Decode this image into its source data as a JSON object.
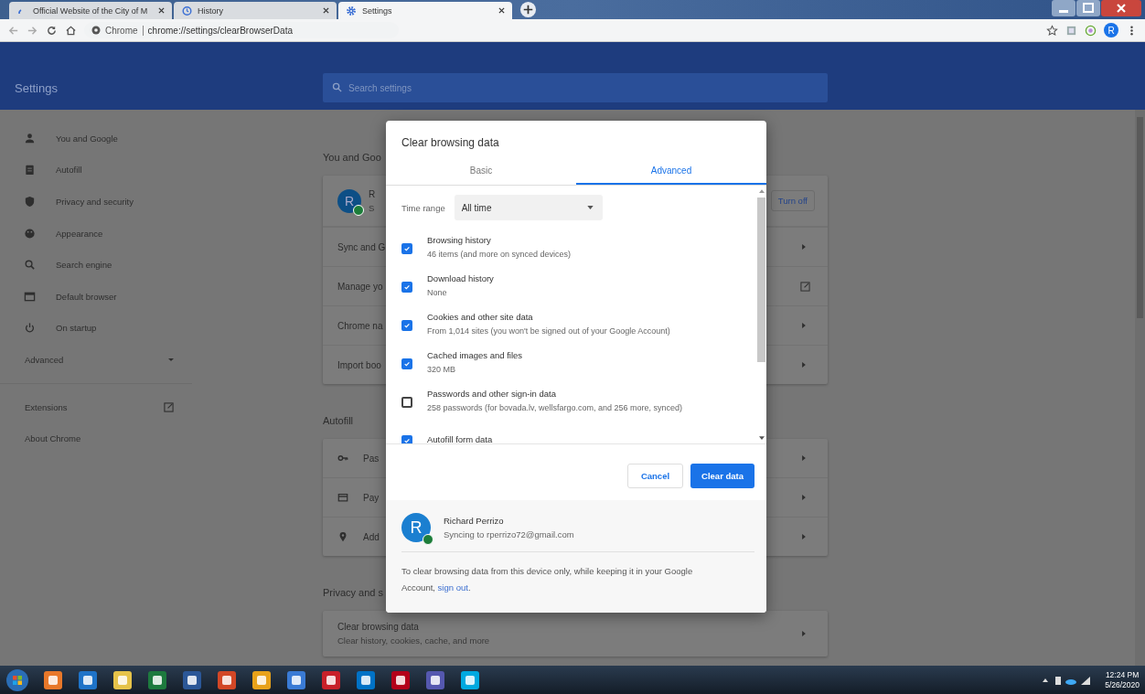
{
  "browser": {
    "tabs": [
      {
        "title": "Official Website of the City of M",
        "selected": false
      },
      {
        "title": "History",
        "selected": false
      },
      {
        "title": "Settings",
        "selected": true
      }
    ],
    "address": {
      "site": "Chrome",
      "url": "chrome://settings/clearBrowserData"
    },
    "profile_initial": "R"
  },
  "settings": {
    "title": "Settings",
    "search": {
      "placeholder": "Search settings"
    },
    "sidebar": {
      "items": [
        {
          "label": "You and Google"
        },
        {
          "label": "Autofill"
        },
        {
          "label": "Privacy and security"
        },
        {
          "label": "Appearance"
        },
        {
          "label": "Search engine"
        },
        {
          "label": "Default browser"
        },
        {
          "label": "On startup"
        }
      ],
      "advanced": {
        "label": "Advanced",
        "expanded": false
      },
      "links": [
        {
          "label": "Extensions",
          "external": true
        },
        {
          "label": "About Chrome",
          "external": false
        }
      ]
    },
    "sections": [
      {
        "heading": "You and Goo",
        "profile": {
          "initial": "R",
          "name": "R",
          "status": "S",
          "button": "Turn off"
        },
        "rows": [
          {
            "label": "Sync and G",
            "kind": "arrow"
          },
          {
            "label": "Manage yo",
            "kind": "external"
          },
          {
            "label": "Chrome na",
            "kind": "arrow"
          },
          {
            "label": "Import boo",
            "kind": "arrow"
          }
        ]
      },
      {
        "heading": "Autofill",
        "rows": [
          {
            "label": "Pas",
            "kind": "arrow"
          },
          {
            "label": "Pay",
            "kind": "arrow"
          },
          {
            "label": "Add",
            "kind": "arrow"
          }
        ]
      },
      {
        "heading": "Privacy and s",
        "rows": [
          {
            "label": "Clear browsing data",
            "sublabel": "Clear history, cookies, cache, and more",
            "kind": "arrow"
          }
        ]
      }
    ]
  },
  "dialog": {
    "title": "Clear browsing data",
    "tabs": [
      {
        "label": "Basic",
        "selected": false
      },
      {
        "label": "Advanced",
        "selected": true
      }
    ],
    "time_range": {
      "label": "Time range",
      "value": "All time"
    },
    "items": [
      {
        "title": "Browsing history",
        "detail": "46 items (and more on synced devices)",
        "checked": true
      },
      {
        "title": "Download history",
        "detail": "None",
        "checked": true
      },
      {
        "title": "Cookies and other site data",
        "detail": "From 1,014 sites (you won't be signed out of your Google Account)",
        "checked": true
      },
      {
        "title": "Cached images and files",
        "detail": "320 MB",
        "checked": true
      },
      {
        "title": "Passwords and other sign-in data",
        "detail": "258 passwords (for bovada.lv, wellsfargo.com, and 256 more, synced)",
        "checked": false
      },
      {
        "title": "Autofill form data",
        "checked": true
      }
    ],
    "buttons": {
      "cancel": "Cancel",
      "confirm": "Clear data"
    },
    "account": {
      "initial": "R",
      "name": "Richard Perrizo",
      "email": "Syncing to rperrizo72@gmail.com"
    },
    "note": {
      "text": "To clear browsing data from this device only, while keeping it in your Google Account, ",
      "link": "sign out",
      "end": "."
    }
  },
  "taskbar": {
    "time": "12:24 PM",
    "date": "5/26/2020"
  }
}
